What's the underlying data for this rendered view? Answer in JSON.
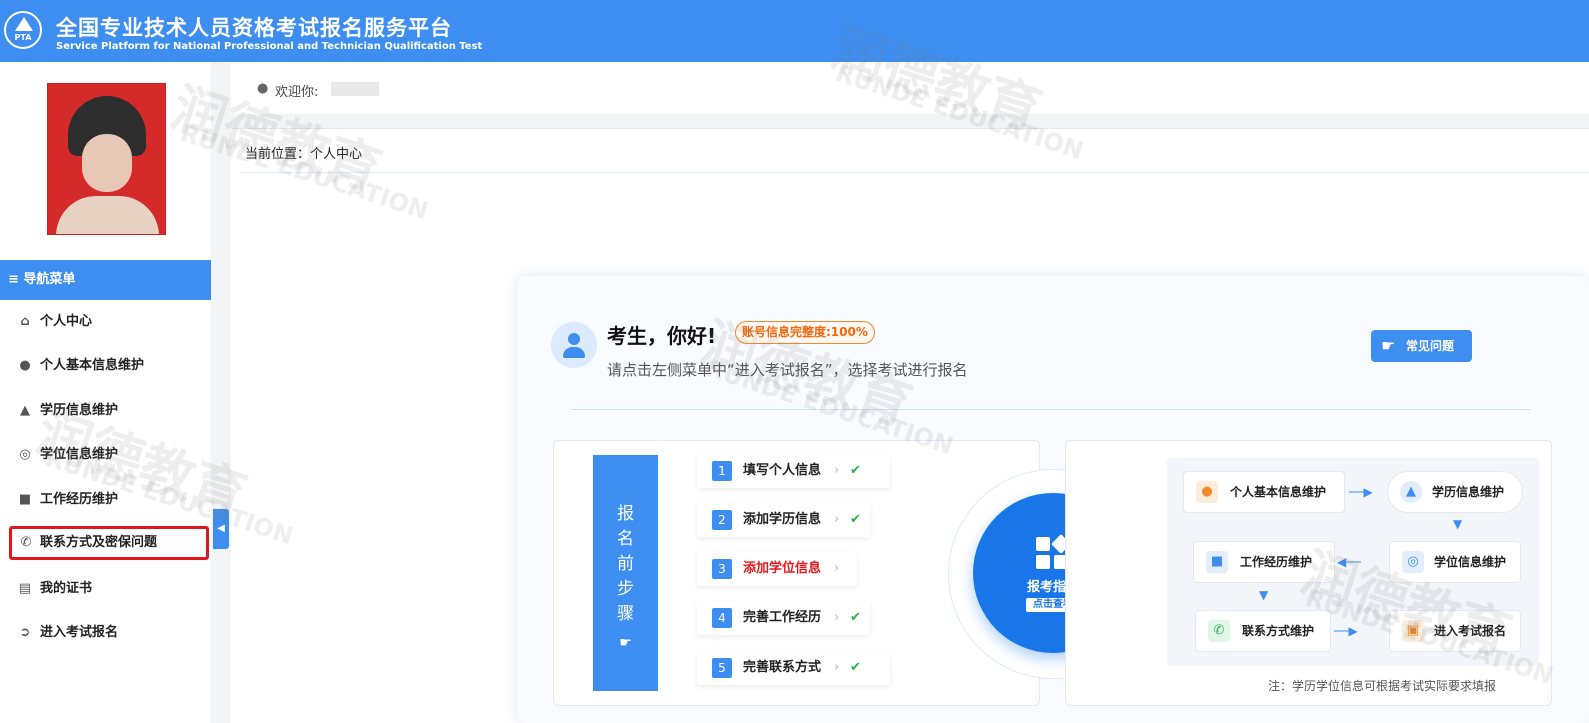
{
  "header": {
    "logo_text": "PTA",
    "title": "全国专业技术人员资格考试报名服务平台",
    "subtitle": "Service Platform for National Professional and Technician Qualification Test"
  },
  "welcome": {
    "label": "欢迎你:"
  },
  "breadcrumb": "当前位置：个人中心",
  "sidebar": {
    "nav_title": "≡ 导航菜单",
    "items": [
      {
        "label": "个人中心",
        "icon": "home-icon"
      },
      {
        "label": "个人基本信息维护",
        "icon": "user-icon"
      },
      {
        "label": "学历信息维护",
        "icon": "graduation-cap-icon"
      },
      {
        "label": "学位信息维护",
        "icon": "medal-icon"
      },
      {
        "label": "工作经历维护",
        "icon": "briefcase-icon"
      },
      {
        "label": "联系方式及密保问题",
        "icon": "phone-icon"
      },
      {
        "label": "我的证书",
        "icon": "book-icon"
      },
      {
        "label": "进入考试报名",
        "icon": "arrow-circle-icon"
      }
    ]
  },
  "main": {
    "greeting": "考生，你好!",
    "completeness": "账号信息完整度:100%",
    "hint": "请点击左侧菜单中“进入考试报名”，选择考试进行报名",
    "faq_label": "常见问题",
    "steps_title": "报名前步骤",
    "steps": [
      {
        "num": "1",
        "label": "填写个人信息",
        "done": true
      },
      {
        "num": "2",
        "label": "添加学历信息",
        "done": true
      },
      {
        "num": "3",
        "label": "添加学位信息",
        "done": false
      },
      {
        "num": "4",
        "label": "完善工作经历",
        "done": true
      },
      {
        "num": "5",
        "label": "完善联系方式",
        "done": true
      }
    ],
    "guide_title": "报考指南",
    "guide_button": "点击查看",
    "flow": {
      "personal": "个人基本信息维护",
      "education": "学历信息维护",
      "degree": "学位信息维护",
      "work": "工作经历维护",
      "contact": "联系方式维护",
      "enter": "进入考试报名"
    },
    "note": "注：学历学位信息可根据考试实际要求填报"
  },
  "watermark": {
    "cn": "润德教育",
    "en": "RUNDE EDUCATION"
  },
  "colors": {
    "brand_blue": "#3d8ef0",
    "highlight_red": "#e4161b",
    "check_green": "#2bb34a",
    "badge_orange": "#f06a10"
  }
}
